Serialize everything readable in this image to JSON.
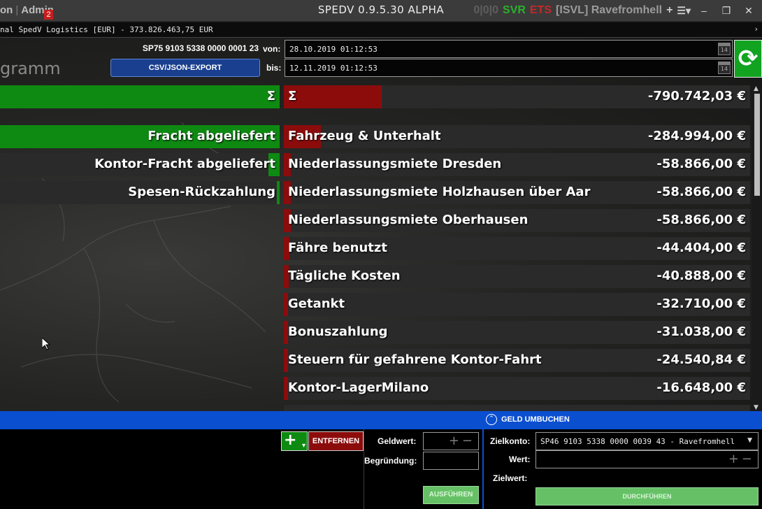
{
  "titlebar": {
    "left_items": [
      "on",
      "Admin"
    ],
    "admin_badge": "2",
    "title": "SPEDV 0.9.5.30 ALPHA",
    "counter": "0|0|0",
    "svr": "SVR",
    "ets": "ETS",
    "user": "[ISVL] Ravefromhell",
    "icons": [
      "plus-icon",
      "layout-icon",
      "minimize-icon",
      "restore-icon",
      "close-icon"
    ]
  },
  "account": {
    "text": "nal SpedV Logistics [EUR] - 373.826.463,75 EUR"
  },
  "header": {
    "iban": "SP75 9103 5338 0000 0001 23",
    "export_label": "CSV/JSON-EXPORT",
    "von_label": "von:",
    "bis_label": "bis:",
    "von_value": "28.10.2019 01:12:53",
    "bis_value": "12.11.2019 01:12:53",
    "calendar_day": "14",
    "section_label": "gramm"
  },
  "income": {
    "sum_label": "Σ",
    "items": [
      {
        "label": "Fracht abgeliefert",
        "fill": 1.0
      },
      {
        "label": "Kontor-Fracht abgeliefert",
        "fill": 0.04
      },
      {
        "label": "Spesen-Rückzahlung",
        "fill": 0.01
      }
    ]
  },
  "expenses": {
    "sum": {
      "label": "Σ",
      "amount": "-790.742,03 €",
      "fill": 0.21
    },
    "items": [
      {
        "label": "Fahrzeug & Unterhalt",
        "amount": "-284.994,00 €",
        "fill": 0.08
      },
      {
        "label": "Niederlassungsmiete Dresden",
        "amount": "-58.866,00 €",
        "fill": 0.015
      },
      {
        "label": "Niederlassungsmiete Holzhausen über Aar",
        "amount": "-58.866,00 €",
        "fill": 0.015
      },
      {
        "label": "Niederlassungsmiete Oberhausen",
        "amount": "-58.866,00 €",
        "fill": 0.015
      },
      {
        "label": "Fähre benutzt",
        "amount": "-44.404,00 €",
        "fill": 0.012
      },
      {
        "label": "Tägliche Kosten",
        "amount": "-40.888,00 €",
        "fill": 0.01
      },
      {
        "label": "Getankt",
        "amount": "-32.710,00 €",
        "fill": 0.009
      },
      {
        "label": "Bonuszahlung",
        "amount": "-31.038,00 €",
        "fill": 0.008
      },
      {
        "label": "Steuern für gefahrene Kontor-Fahrt",
        "amount": "-24.540,84 €",
        "fill": 0.006
      },
      {
        "label": "Kontor-LagerMilano",
        "amount": "-16.648,00 €",
        "fill": 0.004
      }
    ]
  },
  "transfer": {
    "bar_label": "GELD UMBUCHEN",
    "add_label": "+",
    "remove_label": "ENTFERNEN",
    "geldwert_label": "Geldwert:",
    "begruendung_label": "Begründung:",
    "run_label": "AUSFÜHREN",
    "zielkonto_label": "Zielkonto:",
    "zielkonto_value": "SP46 9103 5338 0000 0039 43 - Ravefromhell",
    "wert_label": "Wert:",
    "zielwert_label": "Zielwert:",
    "go_label": "DURCHFÜHREN"
  },
  "colors": {
    "income_green": "#0e8a12",
    "expense_red": "#8c0c0c",
    "accent_blue": "#0b4fd1",
    "refresh_green": "#12a421"
  }
}
